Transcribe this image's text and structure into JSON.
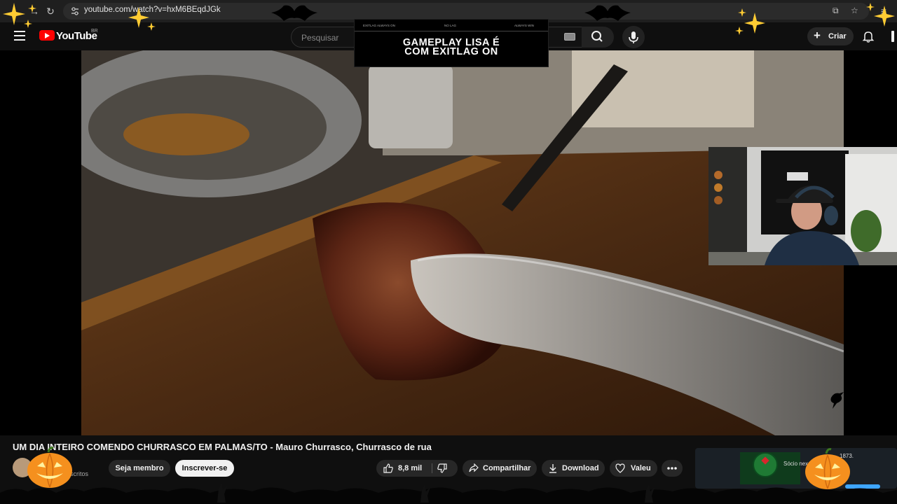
{
  "browser": {
    "url": "youtube.com/watch?v=hxM6BEqdJGk",
    "reload_icon": "reload-icon",
    "tune_icon": "site-info-icon",
    "install_icon": "install-app-icon",
    "star_icon": "bookmark-star-icon",
    "profile_icon": "profile-icon"
  },
  "header": {
    "logo": "YouTube",
    "country": "BR",
    "search_placeholder": "Pesquisar",
    "create_label": "Criar",
    "icons": [
      "menu-icon",
      "search-icon",
      "mic-icon",
      "bell-icon",
      "overflow-icon"
    ]
  },
  "overlay": {
    "tabs": [
      "EXITLAG ALWAYS ON",
      "NO LAG",
      "ALWAYS WIN"
    ],
    "headline_1": "GAMEPLAY LISA É",
    "headline_2": "COM EXITLAG ON"
  },
  "video": {
    "title": "UM DIA INTEIRO COMENDO CHURRASCO EM PALMAS/TO - Mauro Churrasco, Churrasco de rua"
  },
  "channel": {
    "subscribers_fragment": "scritos",
    "member_label": "Seja membro",
    "subscribe_label": "Inscrever-se"
  },
  "actions": {
    "like_count": "8,8 mil",
    "share_label": "Compartilhar",
    "download_label": "Download",
    "thanks_label": "Valeu"
  },
  "recommended": {
    "text_visible": "Sócio nex",
    "text_tail": "1873."
  },
  "colors": {
    "accent_red": "#ff0000",
    "background": "#0f0f0f",
    "pill": "#272727",
    "pumpkin": "#f5901e",
    "sparkle": "#ffcc33",
    "link_blue": "#3ea6ff"
  }
}
